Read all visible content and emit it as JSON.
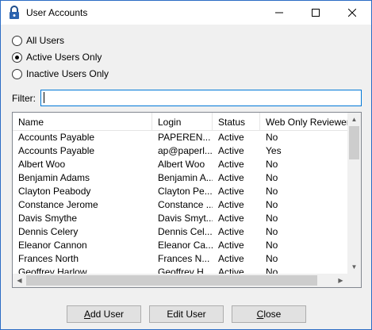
{
  "window": {
    "title": "User Accounts",
    "controls": {
      "minimize": "—",
      "maximize": "☐",
      "close": "✕"
    }
  },
  "filter_options": [
    {
      "label": "All Users",
      "checked": false
    },
    {
      "label": "Active Users Only",
      "checked": true
    },
    {
      "label": "Inactive Users Only",
      "checked": false
    }
  ],
  "filter": {
    "label": "Filter:",
    "value": ""
  },
  "table": {
    "columns": [
      "Name",
      "Login",
      "Status",
      "Web Only Reviewer"
    ],
    "rows": [
      [
        "Accounts Payable",
        "PAPEREN...",
        "Active",
        "No"
      ],
      [
        "Accounts Payable",
        "ap@paperl...",
        "Active",
        "Yes"
      ],
      [
        "Albert Woo",
        "Albert Woo",
        "Active",
        "No"
      ],
      [
        "Benjamin Adams",
        "Benjamin A...",
        "Active",
        "No"
      ],
      [
        "Clayton Peabody",
        "Clayton Pe...",
        "Active",
        "No"
      ],
      [
        "Constance Jerome",
        "Constance ...",
        "Active",
        "No"
      ],
      [
        "Davis Smythe",
        "Davis Smyt...",
        "Active",
        "No"
      ],
      [
        "Dennis Celery",
        "Dennis Cel...",
        "Active",
        "No"
      ],
      [
        "Eleanor Cannon",
        "Eleanor Ca...",
        "Active",
        "No"
      ],
      [
        "Frances North",
        "Frances N...",
        "Active",
        "No"
      ],
      [
        "Geoffrey Harlow",
        "Geoffrey H...",
        "Active",
        "No"
      ]
    ]
  },
  "buttons": {
    "add_prefix": "",
    "add_mnemonic": "A",
    "add_rest": "dd User",
    "edit": "Edit User",
    "close_mnemonic": "C",
    "close_rest": "lose"
  }
}
